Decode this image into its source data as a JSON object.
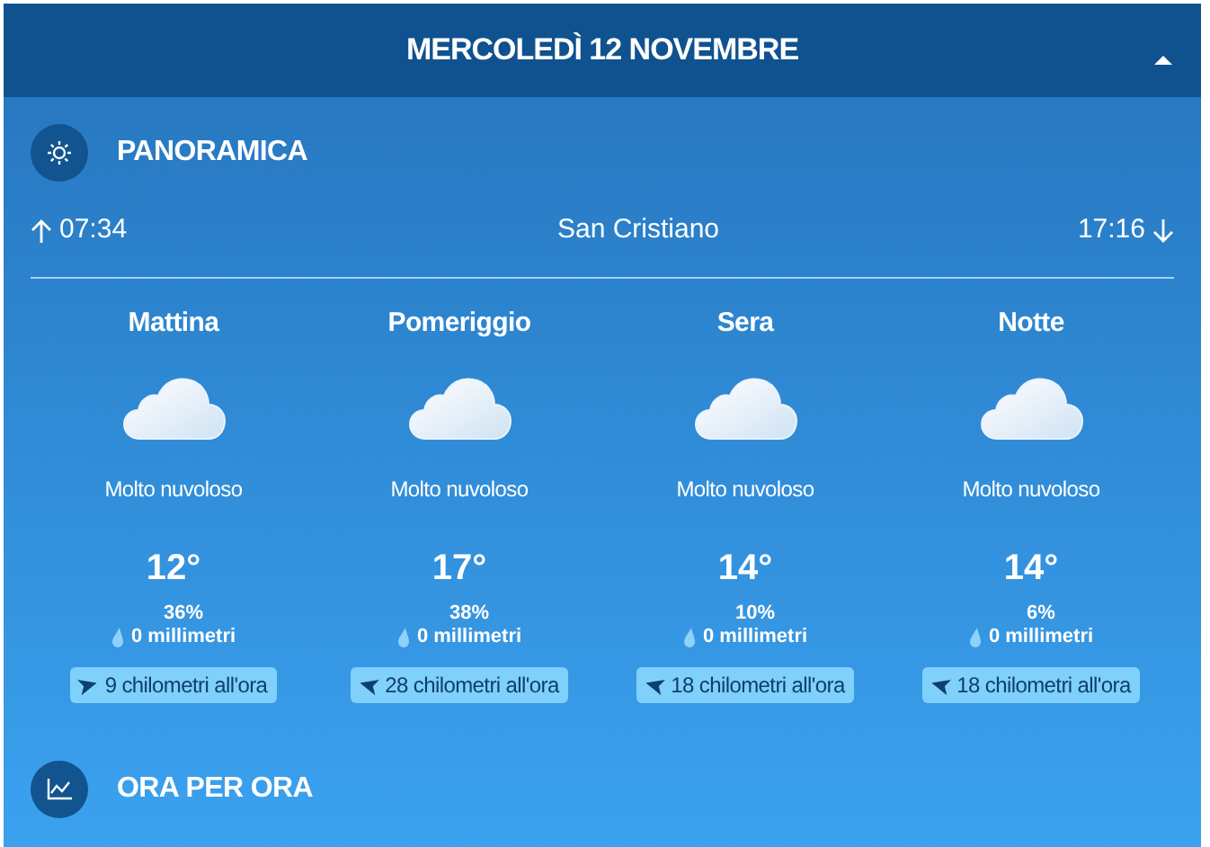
{
  "header": {
    "title": "MERCOLEDÌ 12 NOVEMBRE",
    "expanded": true
  },
  "overview": {
    "title": "PANORAMICA",
    "sunrise": "07:34",
    "location": "San Cristiano",
    "sunset": "17:16"
  },
  "periods": [
    {
      "name": "Mattina",
      "condition": "Molto nuvoloso",
      "temperature": "12°",
      "rain_chance": "36%",
      "rain_amount": "0 millimetri",
      "wind": "9 chilometri all'ora",
      "kind": "east"
    },
    {
      "name": "Pomeriggio",
      "condition": "Molto nuvoloso",
      "temperature": "17°",
      "rain_chance": "38%",
      "rain_amount": "0 millimetri",
      "wind": "28 chilometri all'ora",
      "kind": "west"
    },
    {
      "name": "Sera",
      "condition": "Molto nuvoloso",
      "temperature": "14°",
      "rain_chance": "10%",
      "rain_amount": "0 millimetri",
      "wind": "18 chilometri all'ora",
      "kind": "west"
    },
    {
      "name": "Notte",
      "condition": "Molto nuvoloso",
      "temperature": "14°",
      "rain_chance": "6%",
      "rain_amount": "0 millimetri",
      "wind": "18 chilometri all'ora",
      "kind": "west"
    }
  ],
  "hourly": {
    "title": "ORA PER ORA"
  }
}
